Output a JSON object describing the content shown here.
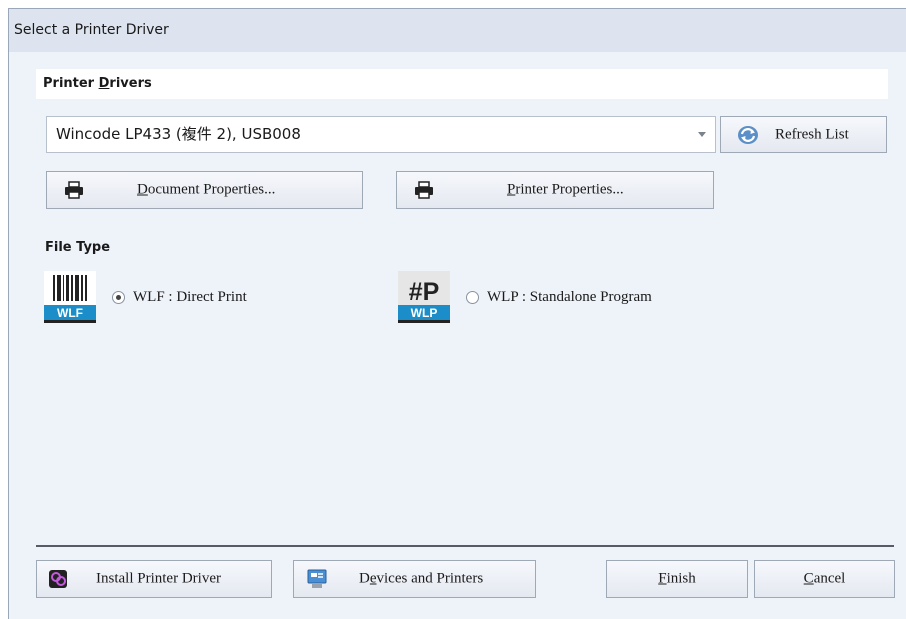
{
  "window": {
    "title": "Select a Printer Driver"
  },
  "printer_drivers": {
    "header": "Printer Drivers",
    "selected_driver": "Wincode LP433 (複件 2), USB008",
    "refresh_label": "Refresh List",
    "document_properties_label": "Document Properties...",
    "printer_properties_label": "Printer Properties..."
  },
  "file_type": {
    "header": "File Type",
    "options": [
      {
        "label": "WLF : Direct Print",
        "icon_text": "WLF",
        "icon": "barcode-wlf-icon",
        "selected": true
      },
      {
        "label": "WLP : Standalone Program",
        "icon_text": "WLP",
        "icon_glyph": "#P",
        "icon": "hash-p-wlp-icon",
        "selected": false
      }
    ]
  },
  "footer": {
    "install_label": "Install Printer Driver",
    "devices_label": "Devices and Printers",
    "finish_label": "Finish",
    "cancel_label": "Cancel"
  },
  "colors": {
    "dialog_bg": "#eef2f9",
    "titlebar_bg": "#dde4ef",
    "icon_blue": "#1b8ec9"
  }
}
